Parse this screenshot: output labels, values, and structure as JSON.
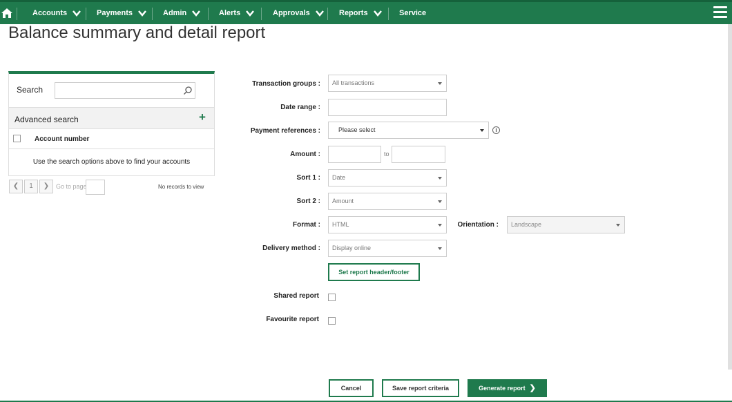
{
  "nav": {
    "items": [
      {
        "label": "Accounts",
        "dropdown": true
      },
      {
        "label": "Payments",
        "dropdown": true
      },
      {
        "label": "Admin",
        "dropdown": true
      },
      {
        "label": "Alerts",
        "dropdown": true
      },
      {
        "label": "Approvals",
        "dropdown": true
      },
      {
        "label": "Reports",
        "dropdown": true
      },
      {
        "label": "Service",
        "dropdown": false
      }
    ],
    "brand_color": "#1f7a4d"
  },
  "page": {
    "title": "Balance summary and detail report"
  },
  "search_panel": {
    "search_label": "Search",
    "search_value": "",
    "advanced_search": "Advanced search",
    "column_header": "Account number",
    "empty_message": "Use the search options above to find your accounts"
  },
  "pager": {
    "page": "1",
    "goto_label": "Go to page",
    "no_records": "No records to view"
  },
  "form": {
    "transaction_groups": {
      "label": "Transaction groups :",
      "value": "All transactions"
    },
    "date_range": {
      "label": "Date range :",
      "value": ""
    },
    "payment_references": {
      "label": "Payment references :",
      "value": "Please select"
    },
    "amount": {
      "label": "Amount :",
      "to": "to",
      "from_value": "",
      "to_value": ""
    },
    "sort1": {
      "label": "Sort 1 :",
      "value": "Date"
    },
    "sort2": {
      "label": "Sort 2 :",
      "value": "Amount"
    },
    "format": {
      "label": "Format :",
      "value": "HTML"
    },
    "orientation": {
      "label": "Orientation :",
      "value": "Landscape"
    },
    "delivery_method": {
      "label": "Delivery method :",
      "value": "Display online"
    },
    "header_footer_button": "Set report header/footer",
    "shared_report": {
      "label": "Shared report",
      "checked": false
    },
    "favourite_report": {
      "label": "Favourite report",
      "checked": false
    }
  },
  "actions": {
    "cancel": "Cancel",
    "save": "Save report criteria",
    "generate": "Generate report"
  }
}
